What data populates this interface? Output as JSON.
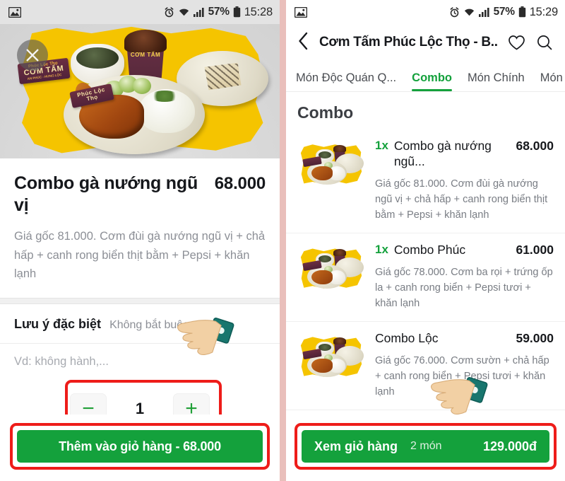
{
  "left": {
    "statusbar": {
      "gallery_icon": "image-icon",
      "alarm_icon": "alarm-icon",
      "wifi_icon": "wifi-icon",
      "signal_icon": "signal-icon",
      "battery_pct": "57%",
      "battery_icon": "battery-icon",
      "time": "15:28"
    },
    "close_label": "×",
    "dish": {
      "title": "Combo gà nướng ngũ vị",
      "price": "68.000",
      "description": "Giá gốc 81.000. Cơm đùi gà nướng ngũ vị + chả hấp + canh rong biển thịt bằm + Pepsi + khăn lạnh"
    },
    "note": {
      "title": "Lưu ý đặc biệt",
      "subtitle": "Không bắt buộc",
      "placeholder": "Vd: không hành,...",
      "value": ""
    },
    "quantity": {
      "minus_label": "−",
      "value": "1",
      "plus_label": "+"
    },
    "cta": "Thêm vào giỏ hàng - 68.000"
  },
  "right": {
    "statusbar": {
      "gallery_icon": "image-icon",
      "alarm_icon": "alarm-icon",
      "wifi_icon": "wifi-icon",
      "signal_icon": "signal-icon",
      "battery_pct": "57%",
      "battery_icon": "battery-icon",
      "time": "15:29"
    },
    "header": {
      "back_icon": "back-chevron-icon",
      "title": "Cơm Tấm Phúc Lộc Thọ - B...",
      "favorite_icon": "heart-icon",
      "search_icon": "search-icon"
    },
    "tabs": [
      {
        "label": "Món Độc Quán Q...",
        "active": false
      },
      {
        "label": "Combo",
        "active": true
      },
      {
        "label": "Món Chính",
        "active": false
      },
      {
        "label": "Món P",
        "active": false
      }
    ],
    "section_title": "Combo",
    "items": [
      {
        "qty": "1x",
        "name": "Combo gà nướng ngũ...",
        "price": "68.000",
        "desc": "Giá gốc 81.000. Cơm đùi gà nướng ngũ vị + chả hấp + canh rong biển thịt bằm + Pepsi + khăn lạnh"
      },
      {
        "qty": "1x",
        "name": "Combo Phúc",
        "price": "61.000",
        "desc": "Giá gốc 78.000. Cơm ba rọi + trứng ốp la + canh rong biển + Pepsi tươi + khăn lạnh"
      },
      {
        "qty": "",
        "name": "Combo Lộc",
        "price": "59.000",
        "desc": "Giá gốc 76.000. Cơm sườn + chả hấp + canh rong biển + Pepsi tươi + khăn lạnh"
      }
    ],
    "cta": {
      "label": "Xem giỏ hàng",
      "count": "2 món",
      "total": "129.000đ"
    }
  },
  "colors": {
    "brand_green": "#14a13c",
    "annotation_red": "#ee1c19",
    "frame_pink": "#e9bfbb"
  }
}
